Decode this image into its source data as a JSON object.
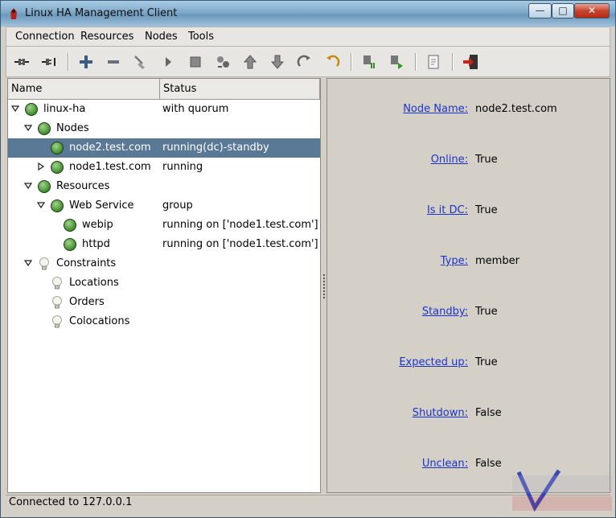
{
  "window": {
    "title": "Linux HA Management Client"
  },
  "menu": [
    "Connection",
    "Resources",
    "Nodes",
    "Tools"
  ],
  "toolbar": {
    "icons": [
      "connect-icon",
      "disconnect-icon",
      "add-icon",
      "remove-icon",
      "cleanup-icon",
      "start-icon",
      "stop-icon",
      "migrate-icon",
      "up-icon",
      "down-icon",
      "redo-icon",
      "undo-icon",
      "standby-icon",
      "active-icon",
      "view-icon",
      "exit-icon"
    ]
  },
  "tree": {
    "headers": {
      "name": "Name",
      "status": "Status"
    },
    "rows": [
      {
        "label": "linux-ha",
        "status": "with quorum"
      },
      {
        "label": "Nodes",
        "status": ""
      },
      {
        "label": "node2.test.com",
        "status": "running(dc)-standby"
      },
      {
        "label": "node1.test.com",
        "status": "running"
      },
      {
        "label": "Resources",
        "status": ""
      },
      {
        "label": "Web Service",
        "status": "group"
      },
      {
        "label": "webip",
        "status": "running on ['node1.test.com']"
      },
      {
        "label": "httpd",
        "status": "running on ['node1.test.com']"
      },
      {
        "label": "Constraints",
        "status": ""
      },
      {
        "label": "Locations",
        "status": ""
      },
      {
        "label": "Orders",
        "status": ""
      },
      {
        "label": "Colocations",
        "status": ""
      }
    ]
  },
  "details": [
    {
      "key": "Node Name:",
      "value": "node2.test.com"
    },
    {
      "key": "Online:",
      "value": "True"
    },
    {
      "key": "Is it DC:",
      "value": "True"
    },
    {
      "key": "Type:",
      "value": "member"
    },
    {
      "key": "Standby:",
      "value": "True"
    },
    {
      "key": "Expected up:",
      "value": "True"
    },
    {
      "key": "Shutdown:",
      "value": "False"
    },
    {
      "key": "Unclean:",
      "value": "False"
    }
  ],
  "status": {
    "text": "Connected to 127.0.0.1"
  },
  "colors": {
    "selection": "#5a7996",
    "link": "#1b33c8",
    "node_green": "#3f8a2e"
  }
}
